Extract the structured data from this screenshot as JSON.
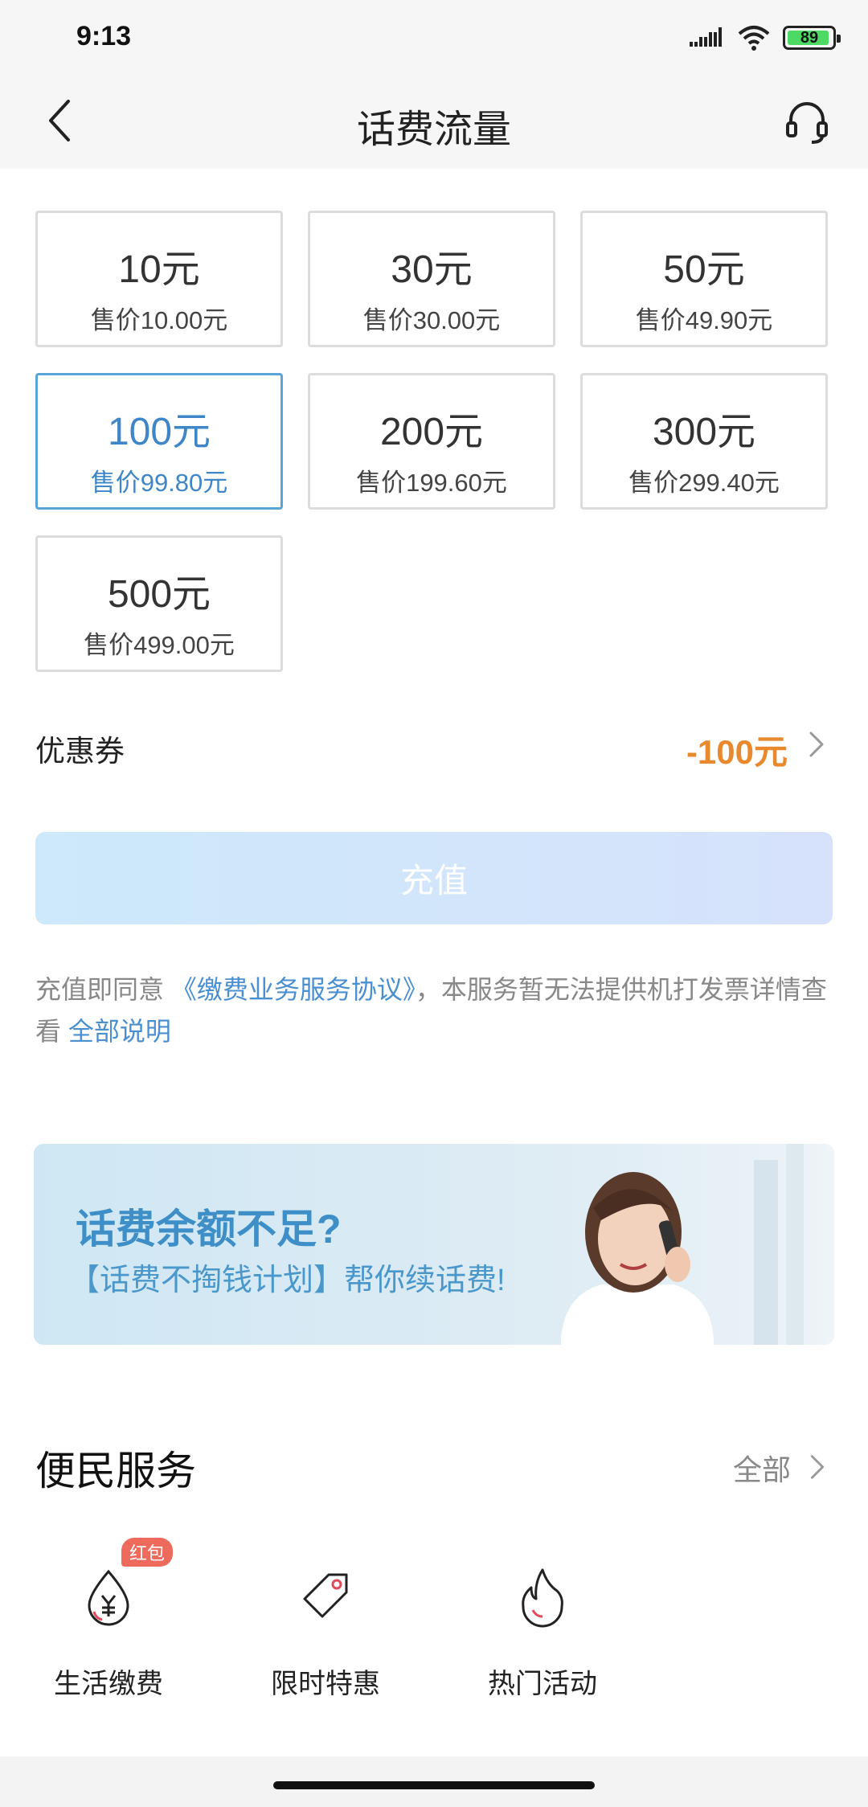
{
  "status_bar": {
    "time": "9:13",
    "battery": "89"
  },
  "header": {
    "title": "话费流量"
  },
  "amounts": [
    {
      "amount": "10元",
      "price": "售价10.00元"
    },
    {
      "amount": "30元",
      "price": "售价30.00元"
    },
    {
      "amount": "50元",
      "price": "售价49.90元"
    },
    {
      "amount": "100元",
      "price": "售价99.80元"
    },
    {
      "amount": "200元",
      "price": "售价199.60元"
    },
    {
      "amount": "300元",
      "price": "售价299.40元"
    },
    {
      "amount": "500元",
      "price": "售价499.00元"
    }
  ],
  "selected_amount": "100元",
  "coupon": {
    "label": "优惠券",
    "value": "-100元"
  },
  "recharge_button": "充值",
  "agreement": {
    "prefix": "充值即同意",
    "link": "《缴费业务服务协议》",
    "middle": "，本服务暂无法提供机打发票详情查看",
    "more_link": "全部说明"
  },
  "banner": {
    "title": "话费余额不足?",
    "subtitle": "【话费不掏钱计划】帮你续话费!"
  },
  "services": {
    "title": "便民服务",
    "all": "全部",
    "items": [
      {
        "label": "生活缴费",
        "icon": "yuan-drop-icon",
        "badge": "红包"
      },
      {
        "label": "限时特惠",
        "icon": "price-tag-icon"
      },
      {
        "label": "热门活动",
        "icon": "flame-icon"
      }
    ]
  },
  "colors": {
    "accent": "#3e86c7",
    "coupon": "#e8892e",
    "badge": "#ee6a5c"
  }
}
